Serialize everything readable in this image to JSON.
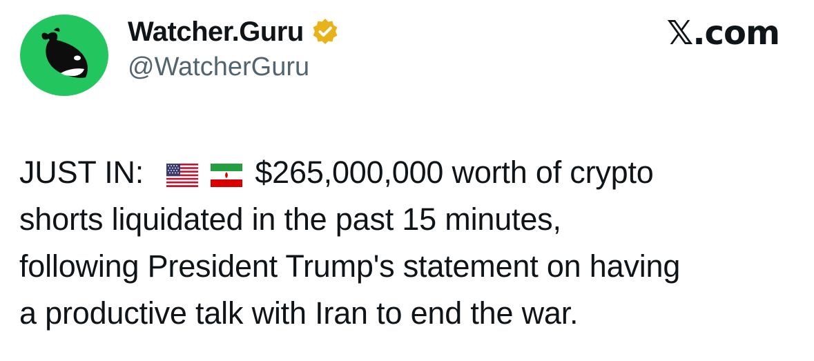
{
  "author": {
    "display_name": "Watcher.Guru",
    "handle": "@WatcherGuru",
    "verified": true,
    "verified_color": "#e8b21a",
    "avatar_bg_color": "#22c55e",
    "avatar_icon": "whale-logo-icon"
  },
  "brand": {
    "label": "𝕏.com"
  },
  "tweet": {
    "prefix": "JUST IN:",
    "flags": [
      "us-flag-icon",
      "iran-flag-icon"
    ],
    "line1_rest": "$265,000,000 worth of crypto",
    "line2": "shorts liquidated in the past 15 minutes,",
    "line3": "following President Trump's statement on having",
    "line4": "a productive talk with Iran to end the war."
  }
}
